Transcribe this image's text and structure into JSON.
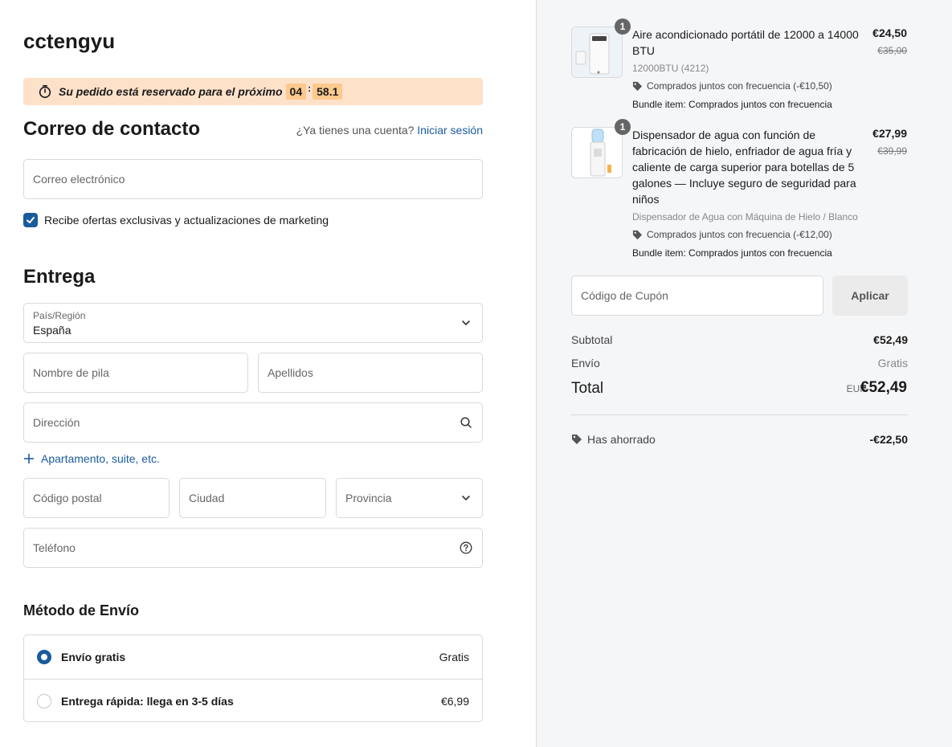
{
  "shop": {
    "name": "cctengyu"
  },
  "timer": {
    "text": "Su pedido está reservado para el próximo",
    "minutes": "04",
    "seconds": "58.1"
  },
  "contact": {
    "title": "Correo de contacto",
    "login_prompt": "¿Ya tienes una cuenta?",
    "login_link": "Iniciar sesión",
    "email_placeholder": "Correo electrónico",
    "marketing_label": "Recibe ofertas exclusivas y actualizaciones de marketing",
    "marketing_checked": true
  },
  "delivery": {
    "title": "Entrega",
    "country_label": "País/Región",
    "country_value": "España",
    "first_name_placeholder": "Nombre de pila",
    "last_name_placeholder": "Apellidos",
    "address_placeholder": "Dirección",
    "add_apartment_label": "Apartamento, suite, etc.",
    "postal_placeholder": "Código postal",
    "city_placeholder": "Ciudad",
    "province_placeholder": "Provincia",
    "phone_placeholder": "Teléfono"
  },
  "shipping": {
    "title": "Método de Envío",
    "options": [
      {
        "label": "Envío gratis",
        "price": "Gratis",
        "selected": true
      },
      {
        "label": "Entrega rápida: llega en 3-5 días",
        "price": "€6,99",
        "selected": false
      }
    ]
  },
  "cart": {
    "items": [
      {
        "quantity": "1",
        "name": "Aire acondicionado portátil de 12000 a 14000 BTU",
        "price": "€24,50",
        "old_price": "€35,00",
        "variant": "12000BTU (4212)",
        "discount": "Comprados juntos con frecuencia (-€10,50)",
        "bundle": "Bundle item: Comprados juntos con frecuencia"
      },
      {
        "quantity": "1",
        "name": "Dispensador de agua con función de fabricación de hielo, enfriador de agua fría y caliente de carga superior para botellas de 5 galones — Incluye seguro de seguridad para niños",
        "price": "€27,99",
        "old_price": "€39,99",
        "variant": "Dispensador de Agua con Máquina de Hielo / Blanco",
        "discount": "Comprados juntos con frecuencia (-€12,00)",
        "bundle": "Bundle item: Comprados juntos con frecuencia"
      }
    ],
    "coupon_placeholder": "Código de Cupón",
    "apply_label": "Aplicar",
    "subtotal_label": "Subtotal",
    "subtotal_value": "€52,49",
    "shipping_label": "Envío",
    "shipping_value": "Gratis",
    "total_label": "Total",
    "total_currency": "EUR",
    "total_value": "€52,49",
    "saved_label": "Has ahorrado",
    "saved_value": "-€22,50"
  },
  "colors": {
    "accent": "#1a5b9c",
    "timer_bg": "#fde1c9",
    "timer_box": "#fcc98e",
    "summary_bg": "#f5f6f8"
  }
}
